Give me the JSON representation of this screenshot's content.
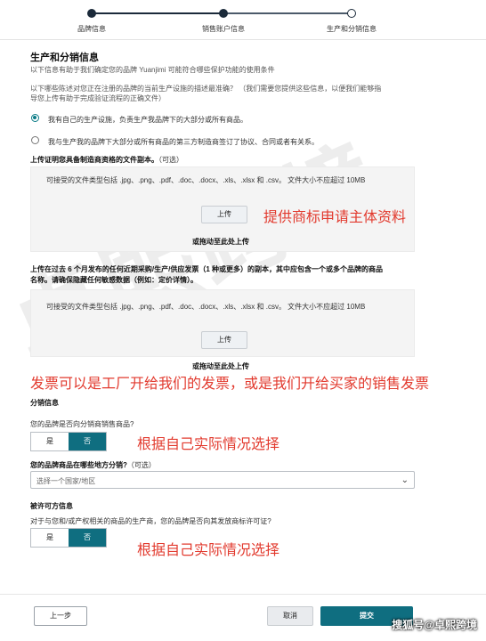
{
  "watermark": {
    "text": "卓熙跨境",
    "sohu": "搜狐号@卓熙跨境"
  },
  "stepper": {
    "steps": [
      {
        "label": "品牌信息",
        "state": "done"
      },
      {
        "label": "销售账户信息",
        "state": "done"
      },
      {
        "label": "生产和分销信息",
        "state": "current"
      }
    ]
  },
  "section": {
    "title": "生产和分销信息",
    "subtitle": "以下信息有助于我们确定您的品牌 Yuanjimi 可能符合哪些保护功能的使用条件",
    "question_line1": "以下哪些陈述对您正在注册的品牌的当前生产设施的描述最准确？ （我们需要您提供这些信息，以便我们能够指",
    "question_line2": "导您上传有助于完成验证流程的正确文件）"
  },
  "radios": [
    {
      "label": "我有自己的生产设施，负责生产我品牌下的大部分或所有商品。",
      "checked": true
    },
    {
      "label": "我与生产我的品牌下大部分或所有商品的第三方制造商签订了协议、合同或者有关系。",
      "checked": false
    }
  ],
  "upload1": {
    "label": "上传证明您具备制造商资格的文件副本。",
    "optional": "（可选）",
    "types": "可接受的文件类型包括 .jpg、.png、.pdf、.doc、.docx、.xls、.xlsx 和 .csv。   文件大小不应超过 10MB",
    "button": "上传",
    "drop": "或拖动至此处上传"
  },
  "annotation1": "提供商标申请主体资料",
  "upload2": {
    "label_line1": "上传在过去 6 个月发布的任何近期采购/生产/供应发票（1 种或更多）的副本，其中应包含一个或多个品牌的商品",
    "label_line2": "名称。请确保隐藏任何敏感数据（例如：定价详情）。",
    "types": "可接受的文件类型包括 .jpg、.png、.pdf、.doc、.docx、.xls、.xlsx 和 .csv。   文件大小不应超过 10MB",
    "button": "上传",
    "drop": "或拖动至此处上传"
  },
  "annotation2": "发票可以是工厂开给我们的发票，或是我们开给买家的销售发票",
  "distribution": {
    "heading": "分销信息",
    "question": "您的品牌是否向分销商销售商品?",
    "yes": "是",
    "no": "否",
    "selected": "否"
  },
  "annotation3": "根据自己实际情况选择",
  "region": {
    "label": "您的品牌商品在哪些地方分销?",
    "optional": "（可选）",
    "placeholder": "选择一个国家/地区"
  },
  "license": {
    "heading": "被许可方信息",
    "question": "对于与您和/或产权相关的商品的生产商，您的品牌是否向其发放商标许可证?",
    "yes": "是",
    "no": "否",
    "selected": "否"
  },
  "annotation4": "根据自己实际情况选择",
  "footer": {
    "back": "上一步",
    "cancel": "取消",
    "next": "提交"
  },
  "colors": {
    "accent": "#0f6e80",
    "annotation": "#e23a2e"
  }
}
